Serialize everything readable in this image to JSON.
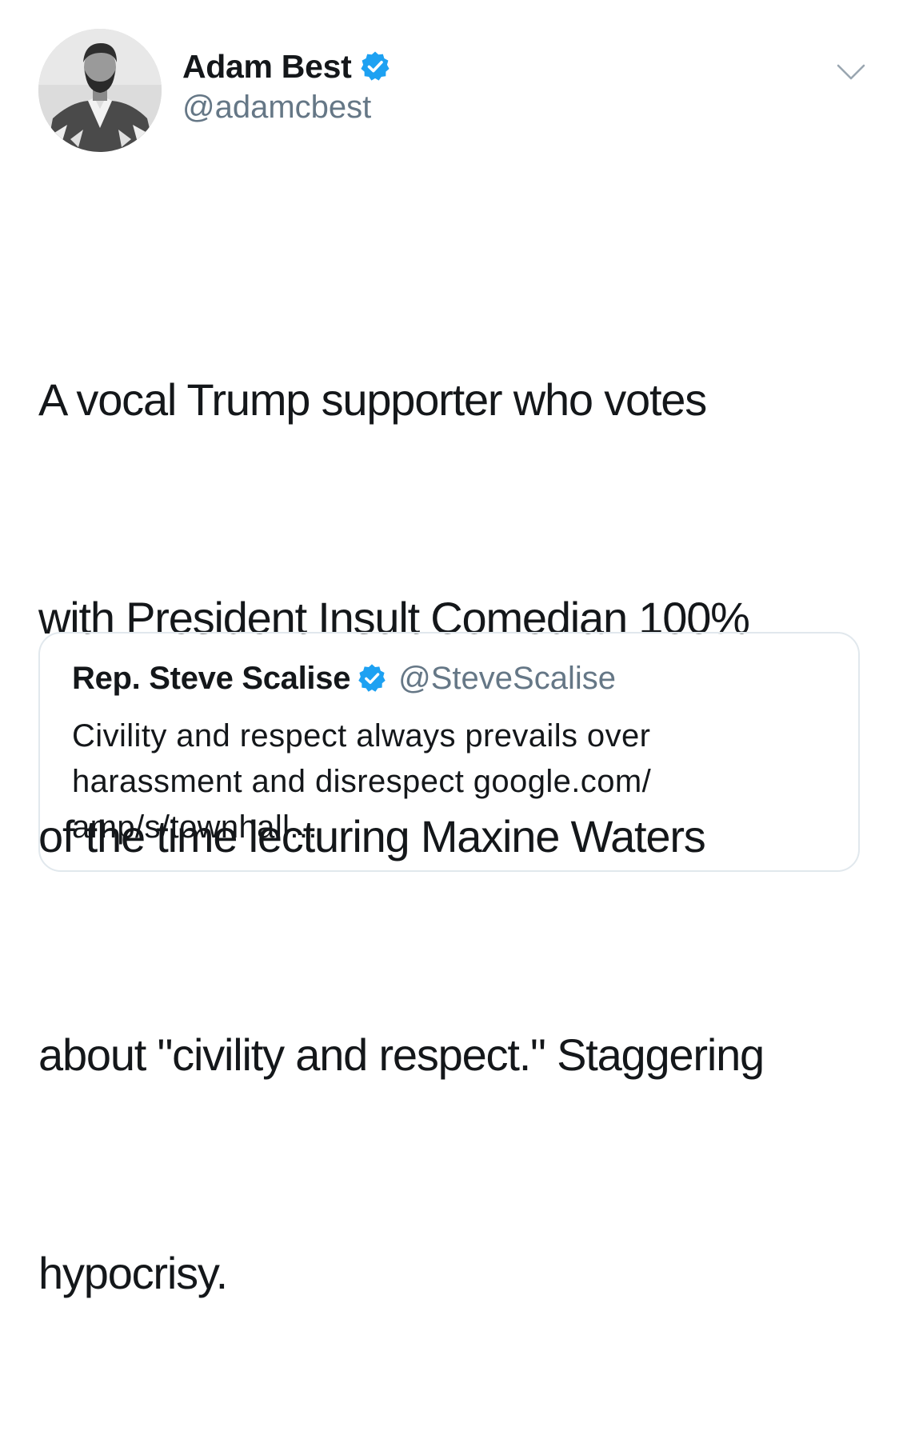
{
  "tweet": {
    "author": {
      "display_name": "Adam Best",
      "handle": "@adamcbest",
      "verified_icon": "verified-badge",
      "avatar_icon": "avatar-photo"
    },
    "menu_icon": "chevron-down",
    "text_lines": [
      "A vocal Trump supporter who votes",
      "with President Insult Comedian 100%",
      "of the time lecturing Maxine Waters",
      "about \"civility and respect.\" Staggering",
      "hypocrisy."
    ],
    "quoted_tweet": {
      "display_name": "Rep. Steve Scalise",
      "handle": "@SteveScalise",
      "verified_icon": "verified-badge",
      "text_lines": [
        "Civility and respect always prevails over",
        "harassment and disrespect google.com/",
        "amp/s/townhall..."
      ]
    }
  },
  "colors": {
    "text_primary": "#14171a",
    "text_secondary": "#657786",
    "verified_blue": "#1da1f2",
    "card_border": "#e1e8ed"
  }
}
